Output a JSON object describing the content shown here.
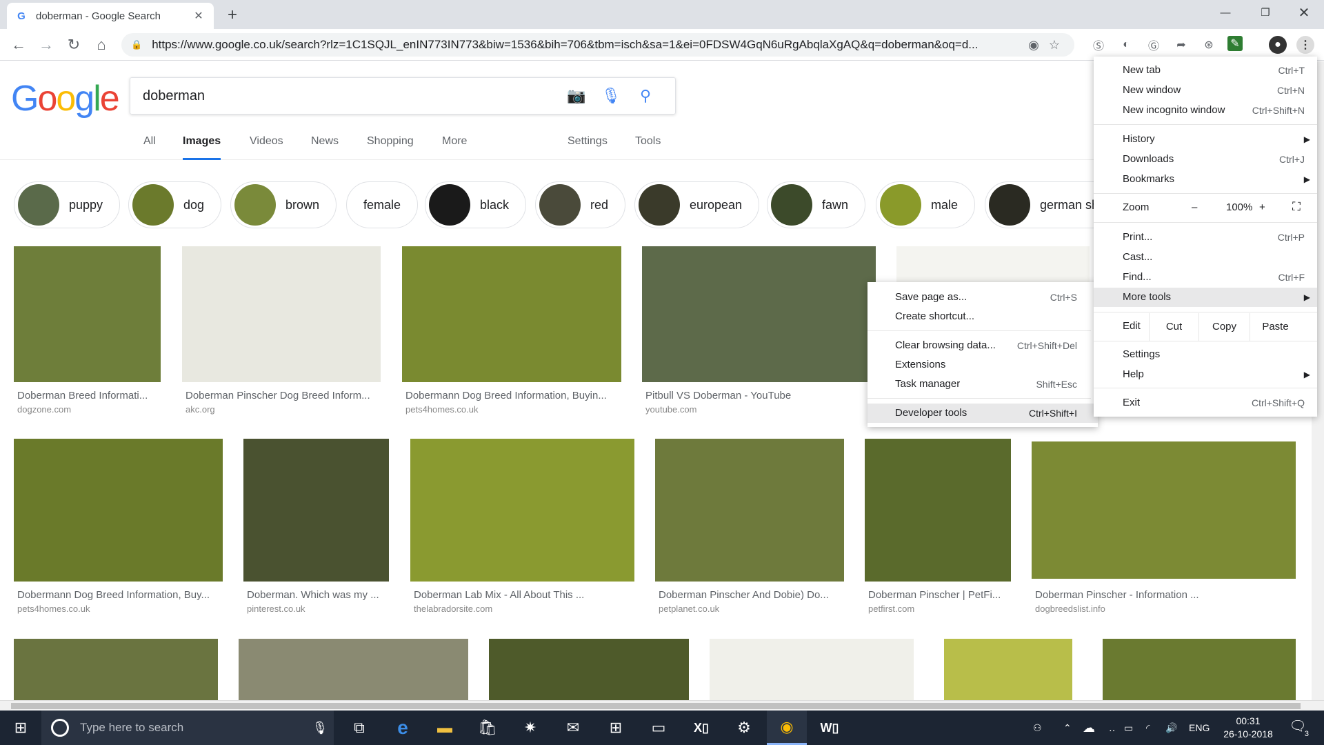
{
  "browser": {
    "tab_title": "doberman - Google Search",
    "tab_favicon": "G",
    "url": "https://www.google.co.uk/search?rlz=1C1SQJL_enIN773IN773&biw=1536&bih=706&tbm=isch&sa=1&ei=0FDSW4GqN6uRgAbqlaXgAQ&q=doberman&oq=d..."
  },
  "google": {
    "logo": "Google",
    "query": "doberman",
    "tabs": [
      "All",
      "Images",
      "Videos",
      "News",
      "Shopping",
      "More",
      "Settings",
      "Tools"
    ],
    "active_tab": "Images"
  },
  "chips": [
    {
      "label": "puppy",
      "color": "#5a6a4a"
    },
    {
      "label": "dog",
      "color": "#6b7a2c"
    },
    {
      "label": "brown",
      "color": "#7a8a3a"
    },
    {
      "label": "female",
      "color": ""
    },
    {
      "label": "black",
      "color": "#1a1a1a"
    },
    {
      "label": "red",
      "color": "#4a4a3a"
    },
    {
      "label": "european",
      "color": "#3a3a2a"
    },
    {
      "label": "fawn",
      "color": "#3c4a2a"
    },
    {
      "label": "male",
      "color": "#8a9a2a"
    },
    {
      "label": "german sh",
      "color": "#2a2a22"
    }
  ],
  "results_row1": [
    {
      "caption": "Doberman Breed Informati...",
      "source": "dogzone.com",
      "color": "#6e7e3a"
    },
    {
      "caption": "Doberman Pinscher Dog Breed Inform...",
      "source": "akc.org",
      "color": "#e8e8e0"
    },
    {
      "caption": "Dobermann Dog Breed Information, Buyin...",
      "source": "pets4homes.co.uk",
      "color": "#7a8a30"
    },
    {
      "caption": "Pitbull VS Doberman - YouTube",
      "source": "youtube.com",
      "color": "#5d6a4a"
    }
  ],
  "results_row2": [
    {
      "caption": "Dobermann Dog Breed Information, Buy...",
      "source": "pets4homes.co.uk",
      "color": "#6a7a2a"
    },
    {
      "caption": "Doberman. Which was my ...",
      "source": "pinterest.co.uk",
      "color": "#4a5230"
    },
    {
      "caption": "Doberman Lab Mix - All About This ...",
      "source": "thelabradorsite.com",
      "color": "#8a9a30"
    },
    {
      "caption": "Doberman Pinscher And Dobie) Do...",
      "source": "petplanet.co.uk",
      "color": "#6e7a3c"
    },
    {
      "caption": "Doberman Pinscher | PetFi...",
      "source": "petfirst.com",
      "color": "#5a6a2c"
    },
    {
      "caption": "Doberman Pinscher - Information ...",
      "source": "dogbreedslist.info",
      "color": "#7c8a34"
    }
  ],
  "results_row3_colors": [
    "#6a7440",
    "#8a8a72",
    "#4e5a2a",
    "#f0f0ea",
    "#b8be4a",
    "#6a7a30"
  ],
  "menu": {
    "items": [
      {
        "label": "New tab",
        "shortcut": "Ctrl+T"
      },
      {
        "label": "New window",
        "shortcut": "Ctrl+N"
      },
      {
        "label": "New incognito window",
        "shortcut": "Ctrl+Shift+N"
      },
      {
        "label": "History",
        "shortcut": ""
      },
      {
        "label": "Downloads",
        "shortcut": "Ctrl+J"
      },
      {
        "label": "Bookmarks",
        "shortcut": ""
      },
      {
        "label": "Print...",
        "shortcut": "Ctrl+P"
      },
      {
        "label": "Cast...",
        "shortcut": ""
      },
      {
        "label": "Find...",
        "shortcut": "Ctrl+F"
      },
      {
        "label": "More tools",
        "shortcut": ""
      },
      {
        "label": "Settings",
        "shortcut": ""
      },
      {
        "label": "Help",
        "shortcut": ""
      },
      {
        "label": "Exit",
        "shortcut": "Ctrl+Shift+Q"
      }
    ],
    "zoom_label": "Zoom",
    "zoom_minus": "–",
    "zoom_value": "100%",
    "zoom_plus": "+",
    "edit_label": "Edit",
    "cut": "Cut",
    "copy": "Copy",
    "paste": "Paste"
  },
  "submenu": {
    "items": [
      {
        "label": "Save page as...",
        "shortcut": "Ctrl+S"
      },
      {
        "label": "Create shortcut...",
        "shortcut": ""
      },
      {
        "label": "Clear browsing data...",
        "shortcut": "Ctrl+Shift+Del"
      },
      {
        "label": "Extensions",
        "shortcut": ""
      },
      {
        "label": "Task manager",
        "shortcut": "Shift+Esc"
      },
      {
        "label": "Developer tools",
        "shortcut": "Ctrl+Shift+I"
      }
    ]
  },
  "taskbar": {
    "search_placeholder": "Type here to search",
    "language": "ENG",
    "time": "00:31",
    "date": "26-10-2018",
    "notification_count": "3"
  }
}
